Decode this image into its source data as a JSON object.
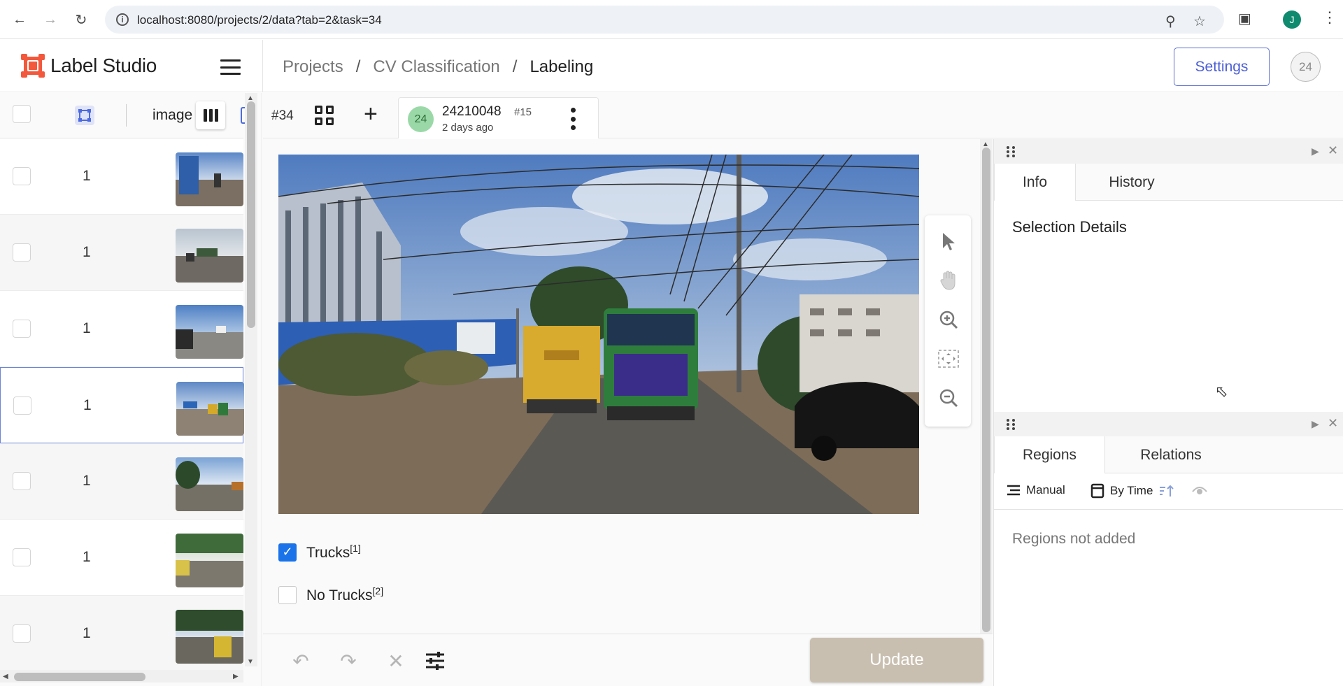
{
  "browser": {
    "url": "localhost:8080/projects/2/data?tab=2&task=34",
    "profile_initial": "J"
  },
  "header": {
    "logo_text": "Label Studio",
    "breadcrumb": [
      "Projects",
      "CV Classification",
      "Labeling"
    ],
    "breadcrumb_separator": "/",
    "settings_label": "Settings",
    "user_badge": "24"
  },
  "list": {
    "column_label": "image",
    "rows": [
      {
        "value": "1"
      },
      {
        "value": "1"
      },
      {
        "value": "1"
      },
      {
        "value": "1",
        "selected": true
      },
      {
        "value": "1"
      },
      {
        "value": "1"
      },
      {
        "value": "1"
      }
    ]
  },
  "task": {
    "id": "#34",
    "annotation": {
      "avatar": "24",
      "name": "24210048",
      "number": "#15",
      "time": "2 days ago"
    }
  },
  "choices": [
    {
      "label": "Trucks",
      "hotkey": "[1]",
      "checked": true
    },
    {
      "label": "No Trucks",
      "hotkey": "[2]",
      "checked": false
    }
  ],
  "bottom": {
    "update_label": "Update"
  },
  "info_panel": {
    "tabs": [
      "Info",
      "History"
    ],
    "active_tab": "Info",
    "title": "Selection Details"
  },
  "regions_panel": {
    "tabs": [
      "Regions",
      "Relations"
    ],
    "active_tab": "Regions",
    "order_label": "Manual",
    "sort_label": "By Time",
    "empty_text": "Regions not added"
  },
  "colors": {
    "accent": "#4c5fd5",
    "logo": "#f3583c",
    "checkbox_checked": "#1a73e8",
    "update_disabled": "#c9bfb0"
  }
}
